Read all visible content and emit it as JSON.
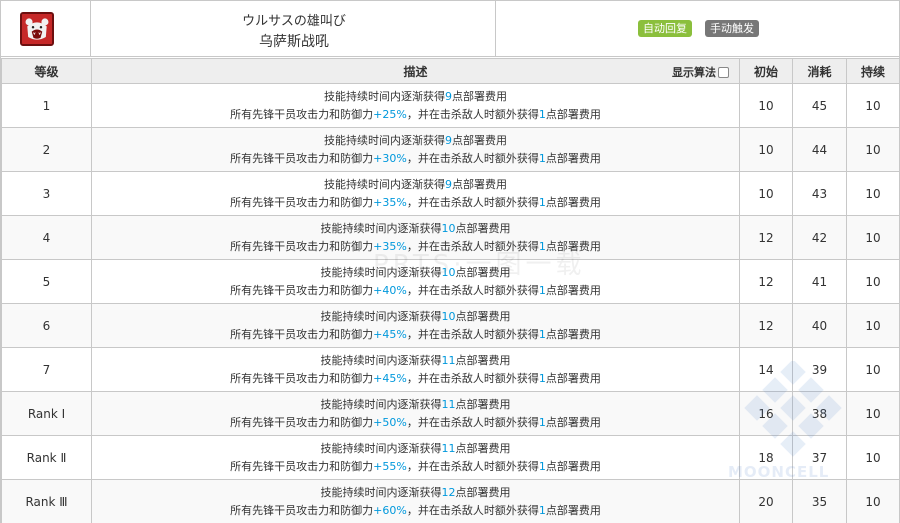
{
  "skill": {
    "name_jp": "ウルサスの雄叫び",
    "name_cn": "乌萨斯战吼",
    "icon": "roaring-bear-icon",
    "badges": {
      "recovery": "自动回复",
      "trigger": "手动触发"
    }
  },
  "table": {
    "headers": {
      "level": "等级",
      "description": "描述",
      "algorithm_toggle": "显示算法",
      "initial": "初始",
      "cost": "消耗",
      "duration": "持续"
    },
    "desc_text": {
      "l1_a": "技能持续时间内逐渐获得",
      "l1_b": "点部署费用",
      "l2_a": "所有先锋干员攻击力和防御力",
      "l2_b": "，并在击杀敌人时额外获得",
      "l2_c": "点部署费用"
    },
    "rows": [
      {
        "level": "1",
        "dp_gain": "9",
        "atk_def": "+25%",
        "kill_dp": "1",
        "initial": "10",
        "cost": "45",
        "duration": "10"
      },
      {
        "level": "2",
        "dp_gain": "9",
        "atk_def": "+30%",
        "kill_dp": "1",
        "initial": "10",
        "cost": "44",
        "duration": "10"
      },
      {
        "level": "3",
        "dp_gain": "9",
        "atk_def": "+35%",
        "kill_dp": "1",
        "initial": "10",
        "cost": "43",
        "duration": "10"
      },
      {
        "level": "4",
        "dp_gain": "10",
        "atk_def": "+35%",
        "kill_dp": "1",
        "initial": "12",
        "cost": "42",
        "duration": "10"
      },
      {
        "level": "5",
        "dp_gain": "10",
        "atk_def": "+40%",
        "kill_dp": "1",
        "initial": "12",
        "cost": "41",
        "duration": "10"
      },
      {
        "level": "6",
        "dp_gain": "10",
        "atk_def": "+45%",
        "kill_dp": "1",
        "initial": "12",
        "cost": "40",
        "duration": "10"
      },
      {
        "level": "7",
        "dp_gain": "11",
        "atk_def": "+45%",
        "kill_dp": "1",
        "initial": "14",
        "cost": "39",
        "duration": "10"
      },
      {
        "level": "Rank Ⅰ",
        "dp_gain": "11",
        "atk_def": "+50%",
        "kill_dp": "1",
        "initial": "16",
        "cost": "38",
        "duration": "10"
      },
      {
        "level": "Rank Ⅱ",
        "dp_gain": "11",
        "atk_def": "+55%",
        "kill_dp": "1",
        "initial": "18",
        "cost": "37",
        "duration": "10"
      },
      {
        "level": "Rank Ⅲ",
        "dp_gain": "12",
        "atk_def": "+60%",
        "kill_dp": "1",
        "initial": "20",
        "cost": "35",
        "duration": "10"
      }
    ]
  },
  "watermarks": {
    "center": "PRTS·一图一载",
    "corner": "MOONCELL"
  },
  "colors": {
    "highlight": "#0098dc",
    "badge_auto": "#8bbf3c",
    "badge_manual": "#777777",
    "icon_bg": "#c62828"
  }
}
